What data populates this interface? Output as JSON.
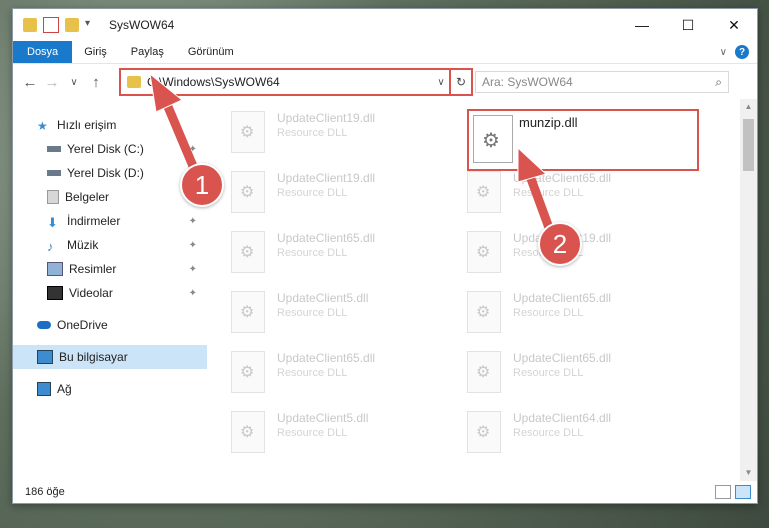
{
  "window": {
    "title": "SysWOW64",
    "controls": {
      "minimize": "—",
      "maximize": "☐",
      "close": "✕"
    }
  },
  "ribbon": {
    "tabs": [
      "Dosya",
      "Giriş",
      "Paylaş",
      "Görünüm"
    ],
    "chevron": "∨",
    "help": "?"
  },
  "nav": {
    "back": "←",
    "forward": "→",
    "recent": "∨",
    "up": "↑",
    "address": "C:\\Windows\\SysWOW64",
    "address_dropdown": "∨",
    "refresh": "↻",
    "search_placeholder": "Ara: SysWOW64",
    "search_icon": "⌕"
  },
  "sidebar": {
    "items": [
      {
        "label": "Hızlı erişim",
        "icon": "star-icon",
        "pinned": false
      },
      {
        "label": "Yerel Disk (C:)",
        "icon": "drive-icon",
        "pinned": true
      },
      {
        "label": "Yerel Disk (D:)",
        "icon": "drive-icon",
        "pinned": false
      },
      {
        "label": "Belgeler",
        "icon": "documents-icon",
        "pinned": false
      },
      {
        "label": "İndirmeler",
        "icon": "download-icon",
        "pinned": true
      },
      {
        "label": "Müzik",
        "icon": "music-icon",
        "pinned": true
      },
      {
        "label": "Resimler",
        "icon": "pictures-icon",
        "pinned": true
      },
      {
        "label": "Videolar",
        "icon": "video-icon",
        "pinned": true
      },
      {
        "label": "OneDrive",
        "icon": "cloud-icon",
        "pinned": false
      },
      {
        "label": "Bu bilgisayar",
        "icon": "computer-icon",
        "pinned": false,
        "selected": true
      },
      {
        "label": "Ağ",
        "icon": "network-icon",
        "pinned": false
      }
    ],
    "pin_glyph": "📌"
  },
  "files": {
    "left_column": [
      {
        "name": "UpdateClient19.dll",
        "type": "Resource DLL"
      },
      {
        "name": "UpdateClient19.dll",
        "type": "Resource DLL"
      },
      {
        "name": "UpdateClient65.dll",
        "type": "Resource DLL"
      },
      {
        "name": "UpdateClient5.dll",
        "type": "Resource DLL"
      },
      {
        "name": "UpdateClient65.dll",
        "type": "Resource DLL"
      },
      {
        "name": "UpdateClient5.dll",
        "type": "Resource DLL"
      }
    ],
    "right_column": [
      {
        "name": "UpdateClient65.dll",
        "type": "Resource DLL"
      },
      {
        "name": "UpdateClient19.dll",
        "type": "Resource DLL"
      },
      {
        "name": "UpdateClient65.dll",
        "type": "Resource DLL"
      },
      {
        "name": "UpdateClient65.dll",
        "type": "Resource DLL"
      },
      {
        "name": "UpdateClient64.dll",
        "type": "Resource DLL"
      }
    ],
    "highlighted": {
      "name": "munzip.dll"
    }
  },
  "status": {
    "count": "186 öğe"
  },
  "annotations": {
    "step1": "1",
    "step2": "2",
    "accent": "#d9534f"
  }
}
